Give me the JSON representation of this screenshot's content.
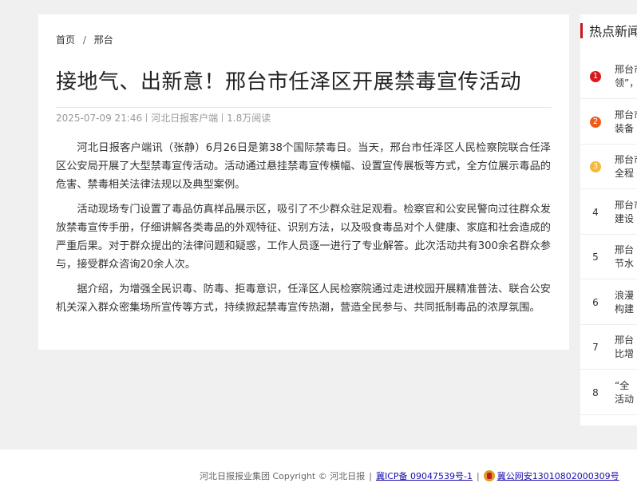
{
  "breadcrumb": {
    "home": "首页",
    "separator": "/",
    "current": "邢台"
  },
  "article": {
    "title": "接地气、出新意！邢台市任泽区开展禁毒宣传活动",
    "date": "2025-07-09 21:46",
    "source": "河北日报客户端",
    "views": "1.8万阅读",
    "paragraphs": [
      "河北日报客户端讯（张静）6月26日是第38个国际禁毒日。当天，邢台市任泽区人民检察院联合任泽区公安局开展了大型禁毒宣传活动。活动通过悬挂禁毒宣传横幅、设置宣传展板等方式，全方位展示毒品的危害、禁毒相关法律法规以及典型案例。",
      "活动现场专门设置了毒品仿真样品展示区，吸引了不少群众驻足观看。检察官和公安民警向过往群众发放禁毒宣传手册，仔细讲解各类毒品的外观特征、识别方法，以及吸食毒品对个人健康、家庭和社会造成的严重后果。对于群众提出的法律问题和疑惑，工作人员逐一进行了专业解答。此次活动共有300余名群众参与，接受群众咨询20余人次。",
      "据介绍，为增强全民识毒、防毒、拒毒意识，任泽区人民检察院通过走进校园开展精准普法、联合公安机关深入群众密集场所宣传等方式，持续掀起禁毒宣传热潮，营造全民参与、共同抵制毒品的浓厚氛围。"
    ]
  },
  "hot_news": {
    "title": "热点新闻",
    "items": [
      {
        "rank": "1",
        "line1": "邢台市",
        "line2": "领”，"
      },
      {
        "rank": "2",
        "line1": "邢台市",
        "line2": "装备"
      },
      {
        "rank": "3",
        "line1": "邢台市",
        "line2": "全程"
      },
      {
        "rank": "4",
        "line1": "邢台市",
        "line2": "建设"
      },
      {
        "rank": "5",
        "line1": "邢台",
        "line2": "节水"
      },
      {
        "rank": "6",
        "line1": "浪漫",
        "line2": "构建"
      },
      {
        "rank": "7",
        "line1": "邢台",
        "line2": "比增"
      },
      {
        "rank": "8",
        "line1": "“全",
        "line2": "活动"
      }
    ],
    "rank_colors": [
      "#d7191c",
      "#f05a1a",
      "#f5b83a"
    ]
  },
  "footer": {
    "org": "河北日报报业集团 Copyright © 河北日报",
    "icp": "冀ICP备 09047539号-1",
    "police": "冀公网安13010802000309号"
  }
}
